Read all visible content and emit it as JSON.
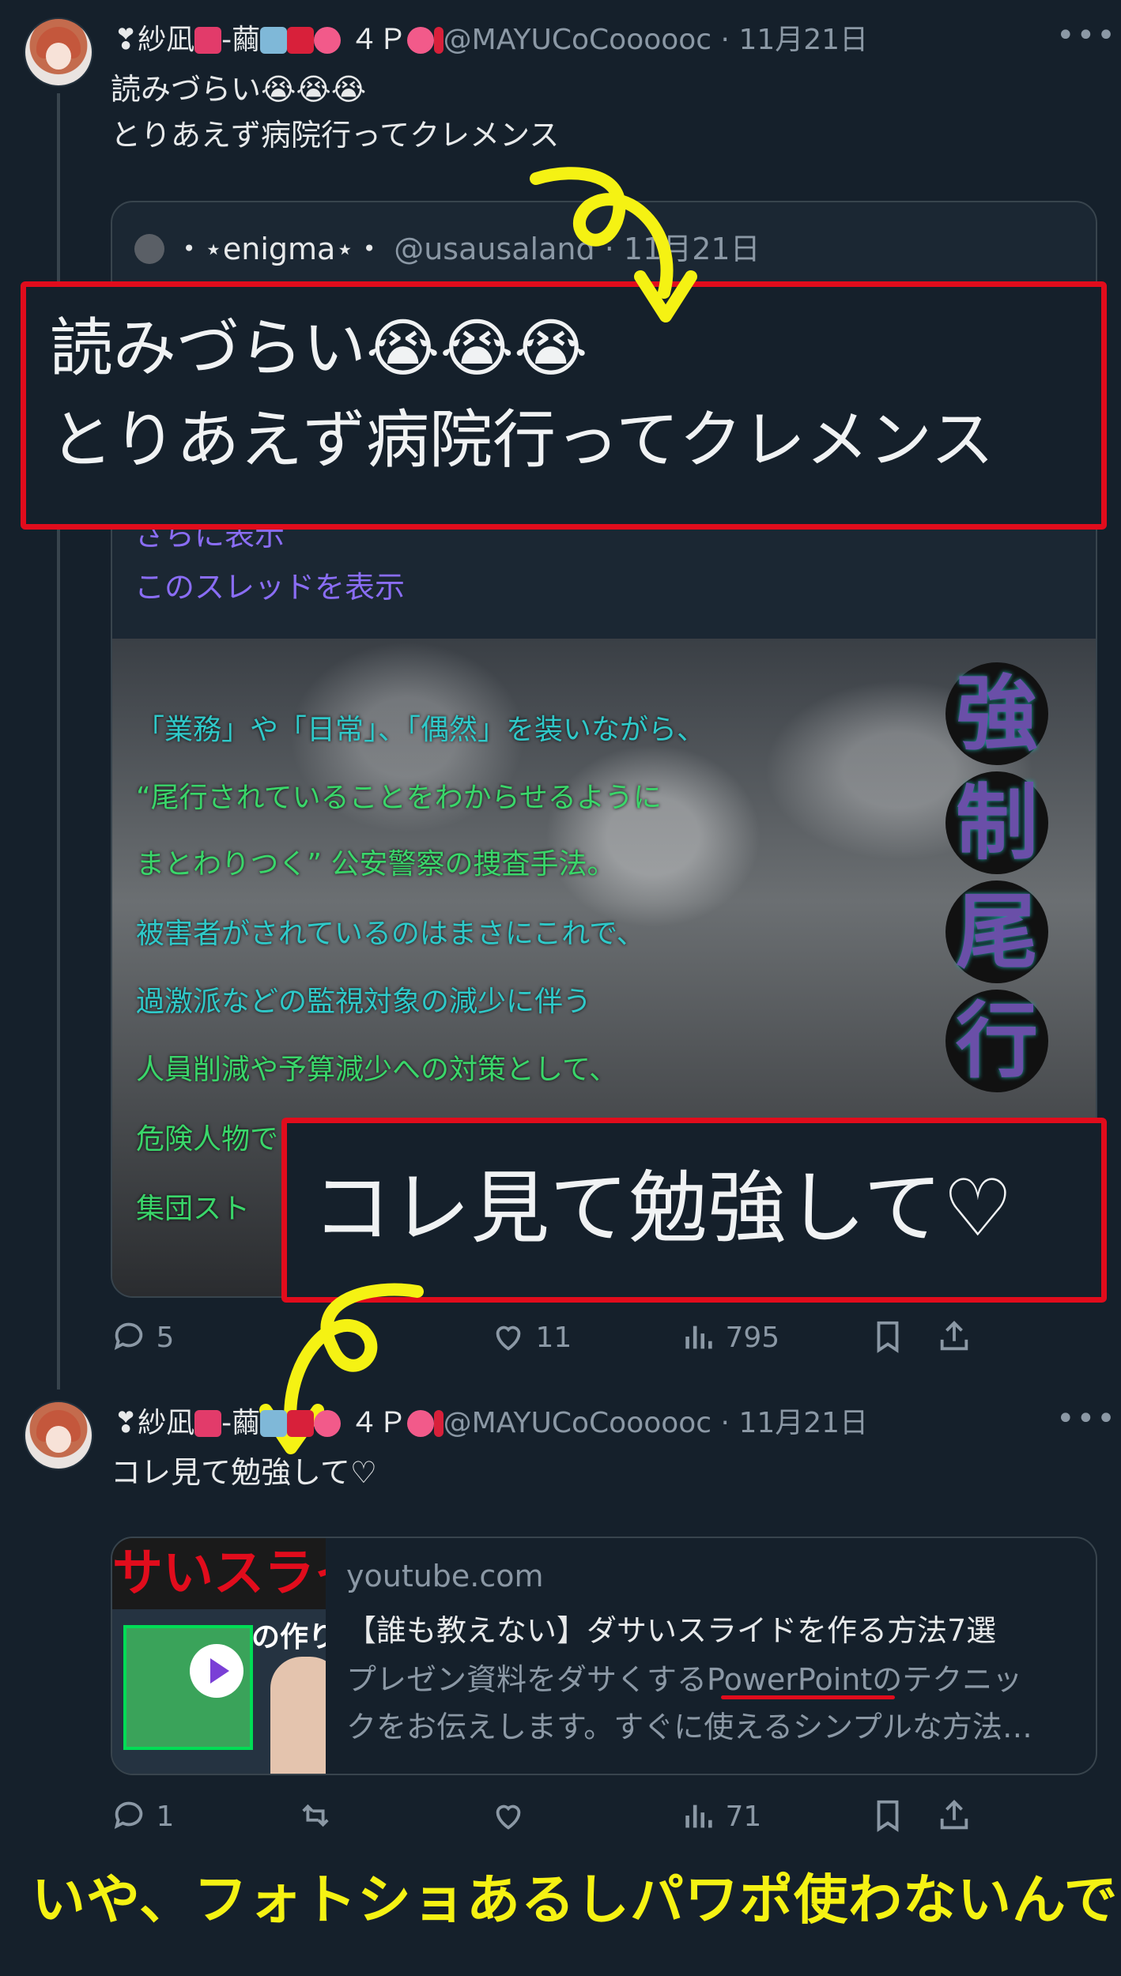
{
  "tweet1": {
    "name_prefix": "❣紗凪",
    "name_mid": "-繭",
    "name_suffix": "４Ｐ",
    "handle": "@MAYUCoCoooooc",
    "separator": "·",
    "date": "11月21日",
    "more": "•••",
    "text_line1": "読みづらい😭😭😭",
    "text_line2": "とりあえず病院行ってクレメンス"
  },
  "quote": {
    "name": "・⋆enigma⋆・",
    "handle": "@usausaland",
    "separator": "·",
    "date": "11月21日",
    "show_more": "さらに表示",
    "show_thread": "このスレッドを表示",
    "image_lines": [
      "「業務」や「日常」、「偶然」を装いながら、",
      "“尾行されていることをわからせるように",
      "まとわりつく” 公安警察の捜査手法。",
      "被害者がされているのはまさにこれで、",
      "過激派などの監視対象の減少に伴う",
      "人員削減や予算減少への対策として、",
      "危険人物で",
      "集団スト"
    ],
    "image_title_chars": [
      "強",
      "制",
      "尾",
      "行"
    ]
  },
  "overlay1": {
    "line1": "読みづらい😭😭😭",
    "line2": "とりあえず病院行ってクレメンス"
  },
  "overlay2": {
    "text": "コレ見て勉強して♡"
  },
  "tweet1_actions": {
    "replies": "5",
    "likes": "11",
    "views": "795"
  },
  "tweet2": {
    "name_prefix": "❣紗凪",
    "name_mid": "-繭",
    "name_suffix": "４Ｐ",
    "handle": "@MAYUCoCoooooc",
    "separator": "·",
    "date": "11月21日",
    "more": "•••",
    "text": "コレ見て勉強して♡"
  },
  "link_card": {
    "domain": "youtube.com",
    "title": "【誰も教えない】ダサいスライドを作る方法7選",
    "desc_before": "プレゼン資料をダサくする",
    "desc_highlight": "PowerPoint",
    "desc_after": "のテクニッ",
    "desc_line2": "クをお伝えします。すぐに使えるシンプルな方法…",
    "thumb_banner": "サいスライ",
    "thumb_sub": "の作り"
  },
  "tweet2_actions": {
    "replies": "1",
    "views": "71"
  },
  "caption": "いや、フォトショあるしパワポ使わないんでｗ",
  "colors": {
    "background": "#15202b",
    "annotation_red": "#e10c1c",
    "annotation_yellow": "#f5f213",
    "link_purple": "#8a6df5"
  }
}
